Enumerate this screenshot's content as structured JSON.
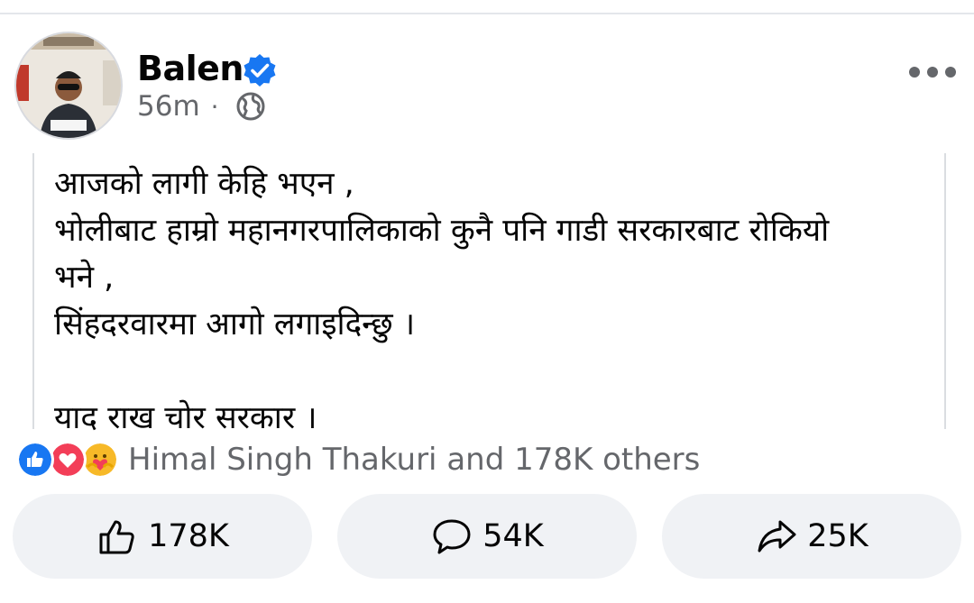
{
  "post": {
    "author": "Balen",
    "time": "56m",
    "text": "आजको लागी केहि भएन ,\nभोलीबाट हाम्रो महानगरपालिकाको कुनै पनि गाडी सरकारबाट रोकियो\nभने ,\nसिंहदरवारमा आगो लगाइदिन्छु ।\n\nयाद राख चोर सरकार ।"
  },
  "reactions": {
    "summary": "Himal Singh Thakuri and 178K others",
    "icons": [
      "like-icon",
      "love-icon",
      "care-icon"
    ]
  },
  "actions": {
    "like_count": "178K",
    "comment_count": "54K",
    "share_count": "25K"
  },
  "colors": {
    "verified": "#1877f2",
    "like": "#1877f2",
    "love": "#f33e58",
    "care": "#f7b928",
    "secondary_text": "#65676b",
    "button_bg": "#f0f2f5"
  }
}
